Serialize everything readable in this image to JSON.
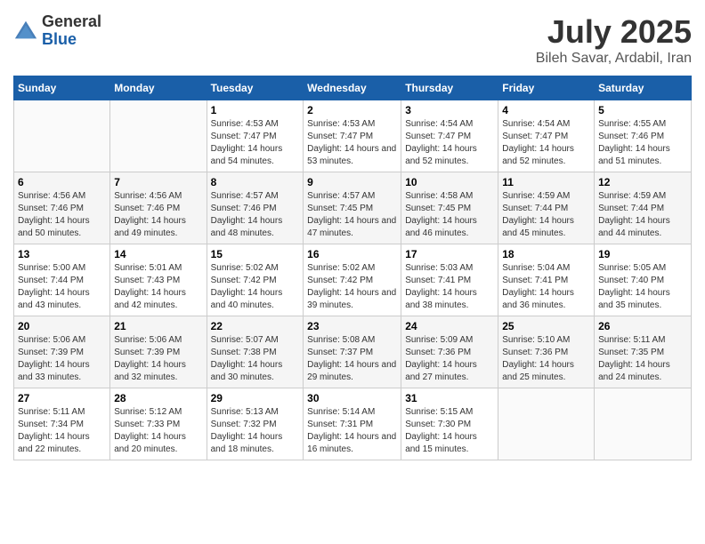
{
  "header": {
    "logo_general": "General",
    "logo_blue": "Blue",
    "month": "July 2025",
    "location": "Bileh Savar, Ardabil, Iran"
  },
  "weekdays": [
    "Sunday",
    "Monday",
    "Tuesday",
    "Wednesday",
    "Thursday",
    "Friday",
    "Saturday"
  ],
  "weeks": [
    [
      {
        "day": "",
        "sunrise": "",
        "sunset": "",
        "daylight": ""
      },
      {
        "day": "",
        "sunrise": "",
        "sunset": "",
        "daylight": ""
      },
      {
        "day": "1",
        "sunrise": "Sunrise: 4:53 AM",
        "sunset": "Sunset: 7:47 PM",
        "daylight": "Daylight: 14 hours and 54 minutes."
      },
      {
        "day": "2",
        "sunrise": "Sunrise: 4:53 AM",
        "sunset": "Sunset: 7:47 PM",
        "daylight": "Daylight: 14 hours and 53 minutes."
      },
      {
        "day": "3",
        "sunrise": "Sunrise: 4:54 AM",
        "sunset": "Sunset: 7:47 PM",
        "daylight": "Daylight: 14 hours and 52 minutes."
      },
      {
        "day": "4",
        "sunrise": "Sunrise: 4:54 AM",
        "sunset": "Sunset: 7:47 PM",
        "daylight": "Daylight: 14 hours and 52 minutes."
      },
      {
        "day": "5",
        "sunrise": "Sunrise: 4:55 AM",
        "sunset": "Sunset: 7:46 PM",
        "daylight": "Daylight: 14 hours and 51 minutes."
      }
    ],
    [
      {
        "day": "6",
        "sunrise": "Sunrise: 4:56 AM",
        "sunset": "Sunset: 7:46 PM",
        "daylight": "Daylight: 14 hours and 50 minutes."
      },
      {
        "day": "7",
        "sunrise": "Sunrise: 4:56 AM",
        "sunset": "Sunset: 7:46 PM",
        "daylight": "Daylight: 14 hours and 49 minutes."
      },
      {
        "day": "8",
        "sunrise": "Sunrise: 4:57 AM",
        "sunset": "Sunset: 7:46 PM",
        "daylight": "Daylight: 14 hours and 48 minutes."
      },
      {
        "day": "9",
        "sunrise": "Sunrise: 4:57 AM",
        "sunset": "Sunset: 7:45 PM",
        "daylight": "Daylight: 14 hours and 47 minutes."
      },
      {
        "day": "10",
        "sunrise": "Sunrise: 4:58 AM",
        "sunset": "Sunset: 7:45 PM",
        "daylight": "Daylight: 14 hours and 46 minutes."
      },
      {
        "day": "11",
        "sunrise": "Sunrise: 4:59 AM",
        "sunset": "Sunset: 7:44 PM",
        "daylight": "Daylight: 14 hours and 45 minutes."
      },
      {
        "day": "12",
        "sunrise": "Sunrise: 4:59 AM",
        "sunset": "Sunset: 7:44 PM",
        "daylight": "Daylight: 14 hours and 44 minutes."
      }
    ],
    [
      {
        "day": "13",
        "sunrise": "Sunrise: 5:00 AM",
        "sunset": "Sunset: 7:44 PM",
        "daylight": "Daylight: 14 hours and 43 minutes."
      },
      {
        "day": "14",
        "sunrise": "Sunrise: 5:01 AM",
        "sunset": "Sunset: 7:43 PM",
        "daylight": "Daylight: 14 hours and 42 minutes."
      },
      {
        "day": "15",
        "sunrise": "Sunrise: 5:02 AM",
        "sunset": "Sunset: 7:42 PM",
        "daylight": "Daylight: 14 hours and 40 minutes."
      },
      {
        "day": "16",
        "sunrise": "Sunrise: 5:02 AM",
        "sunset": "Sunset: 7:42 PM",
        "daylight": "Daylight: 14 hours and 39 minutes."
      },
      {
        "day": "17",
        "sunrise": "Sunrise: 5:03 AM",
        "sunset": "Sunset: 7:41 PM",
        "daylight": "Daylight: 14 hours and 38 minutes."
      },
      {
        "day": "18",
        "sunrise": "Sunrise: 5:04 AM",
        "sunset": "Sunset: 7:41 PM",
        "daylight": "Daylight: 14 hours and 36 minutes."
      },
      {
        "day": "19",
        "sunrise": "Sunrise: 5:05 AM",
        "sunset": "Sunset: 7:40 PM",
        "daylight": "Daylight: 14 hours and 35 minutes."
      }
    ],
    [
      {
        "day": "20",
        "sunrise": "Sunrise: 5:06 AM",
        "sunset": "Sunset: 7:39 PM",
        "daylight": "Daylight: 14 hours and 33 minutes."
      },
      {
        "day": "21",
        "sunrise": "Sunrise: 5:06 AM",
        "sunset": "Sunset: 7:39 PM",
        "daylight": "Daylight: 14 hours and 32 minutes."
      },
      {
        "day": "22",
        "sunrise": "Sunrise: 5:07 AM",
        "sunset": "Sunset: 7:38 PM",
        "daylight": "Daylight: 14 hours and 30 minutes."
      },
      {
        "day": "23",
        "sunrise": "Sunrise: 5:08 AM",
        "sunset": "Sunset: 7:37 PM",
        "daylight": "Daylight: 14 hours and 29 minutes."
      },
      {
        "day": "24",
        "sunrise": "Sunrise: 5:09 AM",
        "sunset": "Sunset: 7:36 PM",
        "daylight": "Daylight: 14 hours and 27 minutes."
      },
      {
        "day": "25",
        "sunrise": "Sunrise: 5:10 AM",
        "sunset": "Sunset: 7:36 PM",
        "daylight": "Daylight: 14 hours and 25 minutes."
      },
      {
        "day": "26",
        "sunrise": "Sunrise: 5:11 AM",
        "sunset": "Sunset: 7:35 PM",
        "daylight": "Daylight: 14 hours and 24 minutes."
      }
    ],
    [
      {
        "day": "27",
        "sunrise": "Sunrise: 5:11 AM",
        "sunset": "Sunset: 7:34 PM",
        "daylight": "Daylight: 14 hours and 22 minutes."
      },
      {
        "day": "28",
        "sunrise": "Sunrise: 5:12 AM",
        "sunset": "Sunset: 7:33 PM",
        "daylight": "Daylight: 14 hours and 20 minutes."
      },
      {
        "day": "29",
        "sunrise": "Sunrise: 5:13 AM",
        "sunset": "Sunset: 7:32 PM",
        "daylight": "Daylight: 14 hours and 18 minutes."
      },
      {
        "day": "30",
        "sunrise": "Sunrise: 5:14 AM",
        "sunset": "Sunset: 7:31 PM",
        "daylight": "Daylight: 14 hours and 16 minutes."
      },
      {
        "day": "31",
        "sunrise": "Sunrise: 5:15 AM",
        "sunset": "Sunset: 7:30 PM",
        "daylight": "Daylight: 14 hours and 15 minutes."
      },
      {
        "day": "",
        "sunrise": "",
        "sunset": "",
        "daylight": ""
      },
      {
        "day": "",
        "sunrise": "",
        "sunset": "",
        "daylight": ""
      }
    ]
  ]
}
